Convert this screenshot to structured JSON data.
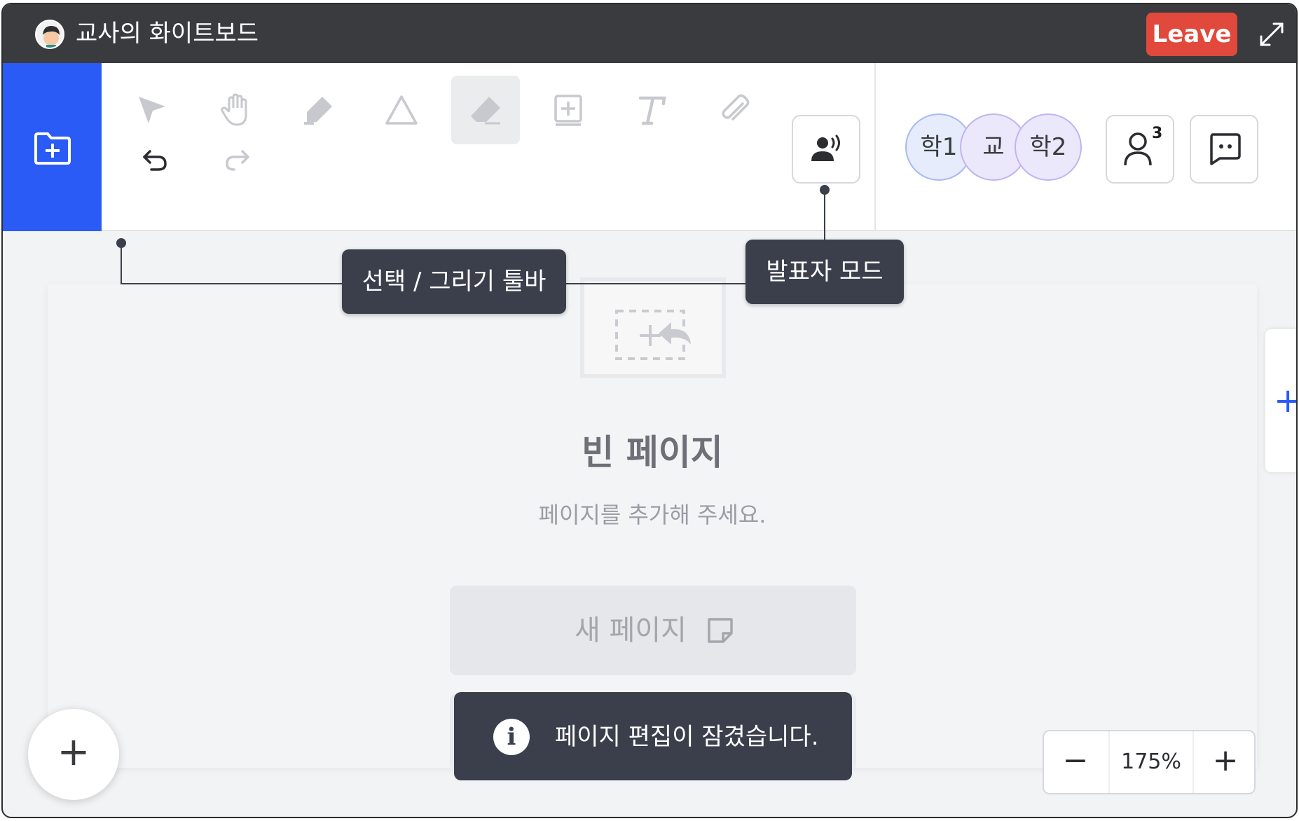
{
  "window": {
    "title": "교사의 화이트보드",
    "leave_label": "Leave",
    "expand_icon": "expand-icon"
  },
  "toolbar": {
    "new_folder_icon": "folder-plus-icon",
    "tools": [
      "select",
      "hand",
      "pen",
      "shape",
      "eraser",
      "insert-image",
      "text",
      "attach"
    ],
    "active_tool": "eraser",
    "undo_icon": "undo-icon",
    "redo_icon": "redo-icon",
    "presenter_icon": "presenter-icon"
  },
  "participants": {
    "avatars": [
      "학1",
      "교",
      "학2"
    ],
    "count": "3"
  },
  "annotations": {
    "toolbar_label": "선택 / 그리기 툴바",
    "presenter_label": "발표자 모드"
  },
  "empty_state": {
    "title": "빈 페이지",
    "subtitle": "페이지를 추가해 주세요.",
    "new_page_label": "새 페이지"
  },
  "toast": {
    "message": "페이지 편집이 잠겼습니다.",
    "icon_text": "i"
  },
  "zoom": {
    "minus": "−",
    "value": "175%",
    "plus": "+"
  },
  "fab": {
    "label": "+"
  },
  "side_tab": {
    "label": "+"
  },
  "colors": {
    "accent": "#2b5bf6",
    "leave": "#e0493c",
    "titlebar": "#3a3b3f",
    "tooltip": "#3a3f4b"
  }
}
